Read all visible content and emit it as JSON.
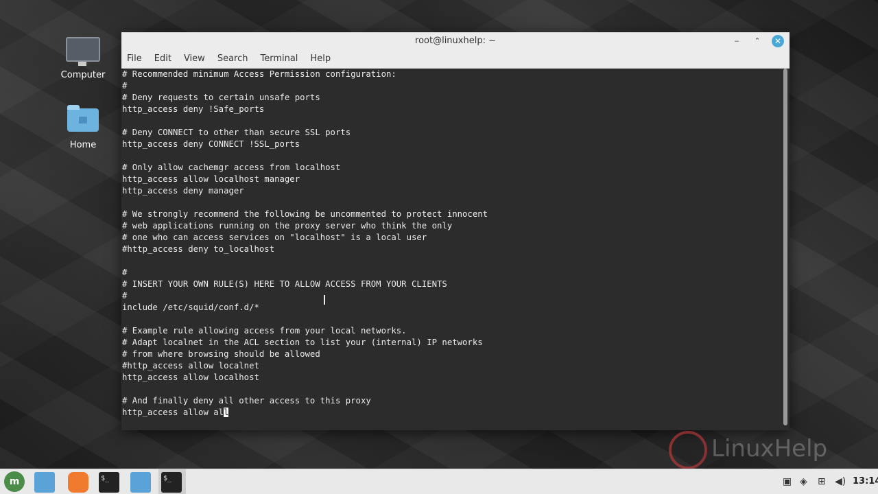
{
  "desktop": {
    "icons": [
      {
        "label": "Computer",
        "icon": "computer-icon"
      },
      {
        "label": "Home",
        "icon": "home-folder-icon"
      }
    ]
  },
  "window": {
    "title": "root@linuxhelp: ~",
    "controls": {
      "minimize": "‒",
      "maximize": "⌃",
      "close": "✕"
    },
    "menu": [
      "File",
      "Edit",
      "View",
      "Search",
      "Terminal",
      "Help"
    ]
  },
  "terminal": {
    "lines": [
      "# Recommended minimum Access Permission configuration:",
      "#",
      "# Deny requests to certain unsafe ports",
      "http_access deny !Safe_ports",
      "",
      "# Deny CONNECT to other than secure SSL ports",
      "http_access deny CONNECT !SSL_ports",
      "",
      "# Only allow cachemgr access from localhost",
      "http_access allow localhost manager",
      "http_access deny manager",
      "",
      "# We strongly recommend the following be uncommented to protect innocent",
      "# web applications running on the proxy server who think the only",
      "# one who can access services on \"localhost\" is a local user",
      "#http_access deny to_localhost",
      "",
      "#",
      "# INSERT YOUR OWN RULE(S) HERE TO ALLOW ACCESS FROM YOUR CLIENTS",
      "#",
      "include /etc/squid/conf.d/*",
      "",
      "# Example rule allowing access from your local networks.",
      "# Adapt localnet in the ACL section to list your (internal) IP networks",
      "# from where browsing should be allowed",
      "#http_access allow localnet",
      "http_access allow localhost",
      "",
      "# And finally deny all other access to this proxy"
    ],
    "last_line_before_cursor": "http_access allow al",
    "cursor_char": "l"
  },
  "watermark": {
    "text": "LinuxHelp"
  },
  "taskbar": {
    "apps": [
      {
        "name": "menu-button",
        "icon": "linux-mint-icon"
      },
      {
        "name": "files",
        "icon": "folder-icon"
      },
      {
        "name": "firefox",
        "icon": "firefox-icon"
      },
      {
        "name": "terminal",
        "icon": "terminal-icon",
        "glyph": "$_"
      },
      {
        "name": "files",
        "icon": "folder-icon"
      },
      {
        "name": "terminal",
        "icon": "terminal-icon",
        "glyph": "$_"
      }
    ],
    "tray": [
      "clipboard-icon",
      "shield-icon",
      "network-icon",
      "volume-icon"
    ],
    "clock": "13:14"
  },
  "colors": {
    "terminal_bg": "#2c2c2c",
    "terminal_fg": "#ececec",
    "titlebar": "#ececec",
    "close_button": "#4aa8d8",
    "taskbar": "#e9e9e9"
  }
}
